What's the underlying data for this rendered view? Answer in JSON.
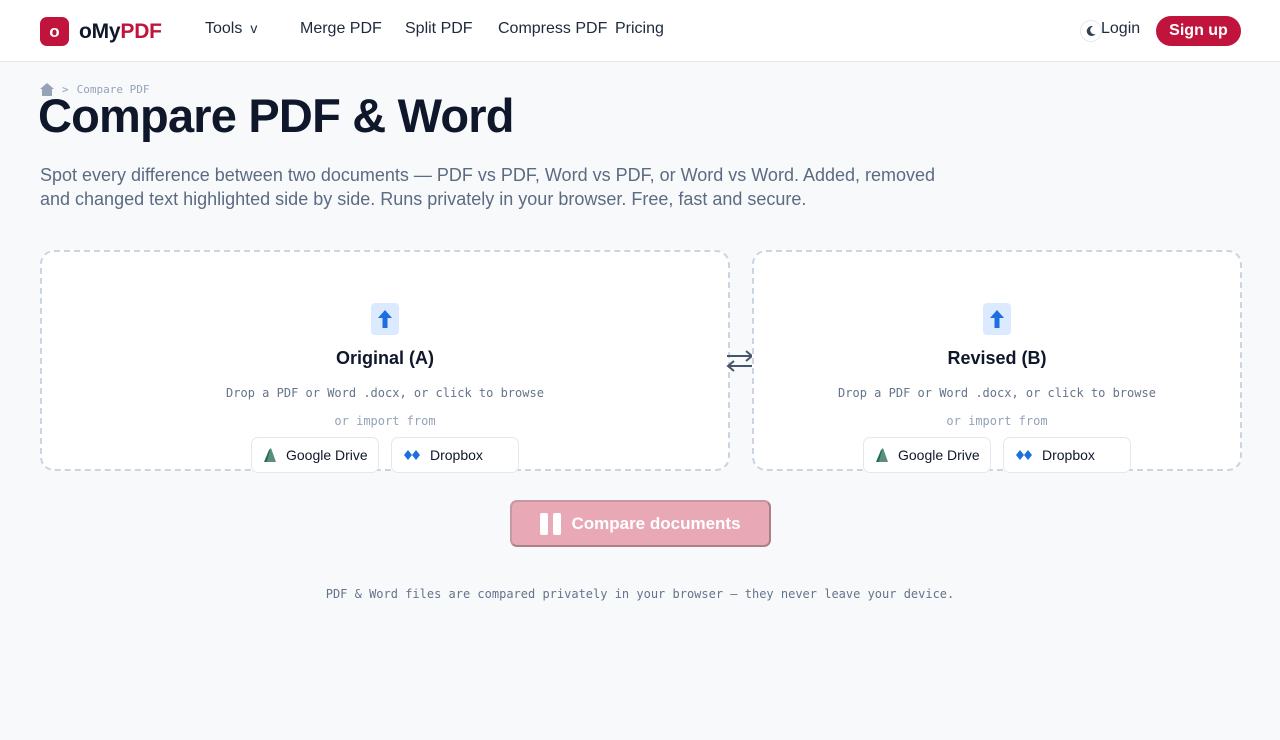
{
  "brand": {
    "mark": "o",
    "name_main": "oMy",
    "name_accent": "PDF",
    "accent_color": "#c0143c"
  },
  "nav": {
    "tools": "Tools",
    "tools_caret": "v",
    "merge": "Merge PDF",
    "split": "Split PDF",
    "compress": "Compress PDF",
    "pricing": "Pricing"
  },
  "auth": {
    "login": "Login",
    "signup": "Sign up",
    "theme_icon": "moon-icon"
  },
  "breadcrumb": {
    "home_icon": "home-icon",
    "separator": ">",
    "current": "Compare PDF"
  },
  "page": {
    "title": "Compare PDF & Word",
    "subtitle": "Spot every difference between two documents — PDF vs PDF, Word vs PDF, or Word vs Word. Added, removed and changed text highlighted side by side. Runs privately in your browser. Free, fast and secure."
  },
  "dropzones": [
    {
      "title": "Original (A)",
      "hint": "Drop a PDF or Word .docx, or click to browse",
      "import_label": "or import from",
      "google_drive": "Google Drive",
      "dropbox": "Dropbox"
    },
    {
      "title": "Revised (B)",
      "hint": "Drop a PDF or Word .docx, or click to browse",
      "import_label": "or import from",
      "google_drive": "Google Drive",
      "dropbox": "Dropbox"
    }
  ],
  "actions": {
    "compare": "Compare documents",
    "compare_disabled": true
  },
  "footer_note": "PDF & Word files are compared privately in your browser — they never leave your device."
}
